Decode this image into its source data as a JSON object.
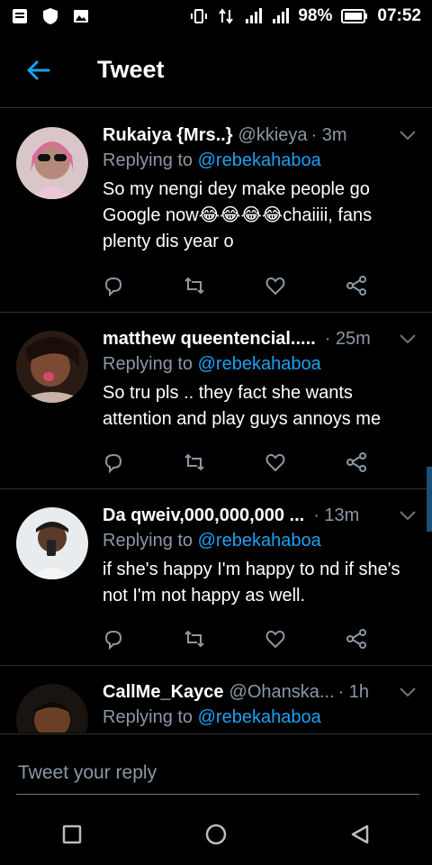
{
  "status_bar": {
    "battery": "98%",
    "time": "07:52"
  },
  "header": {
    "title": "Tweet",
    "back_icon": "arrow-left-icon"
  },
  "colors": {
    "accent": "#1da1f2",
    "secondary_text": "#8b98a5",
    "divider": "#2b2f33"
  },
  "tweets": [
    {
      "author": "Rukaiya {Mrs..}",
      "handle": "@kkieya",
      "time": "· 3m",
      "reply_prefix": "Replying to",
      "reply_to": "@rebekahaboa",
      "text": "So my nengi dey make people go Google now😂😂😂😂chaiiii, fans plenty dis year o"
    },
    {
      "author": "matthew queentencial.....",
      "handle": "",
      "time": "· 25m",
      "reply_prefix": "Replying to",
      "reply_to": "@rebekahaboa",
      "text": "So tru pls .. they fact she wants attention and play guys annoys me"
    },
    {
      "author": "Da qweiv,000,000,000 ...",
      "handle": "",
      "time": "· 13m",
      "reply_prefix": "Replying to",
      "reply_to": "@rebekahaboa",
      "text": "if she's happy I'm happy to nd if she's not I'm not happy as well."
    },
    {
      "author": "CallMe_Kayce",
      "handle": "@Ohanska...",
      "time": "· 1h",
      "reply_prefix": "Replying to",
      "reply_to": "@rebekahaboa",
      "text": ""
    }
  ],
  "reply_box": {
    "placeholder": "Tweet your reply"
  }
}
